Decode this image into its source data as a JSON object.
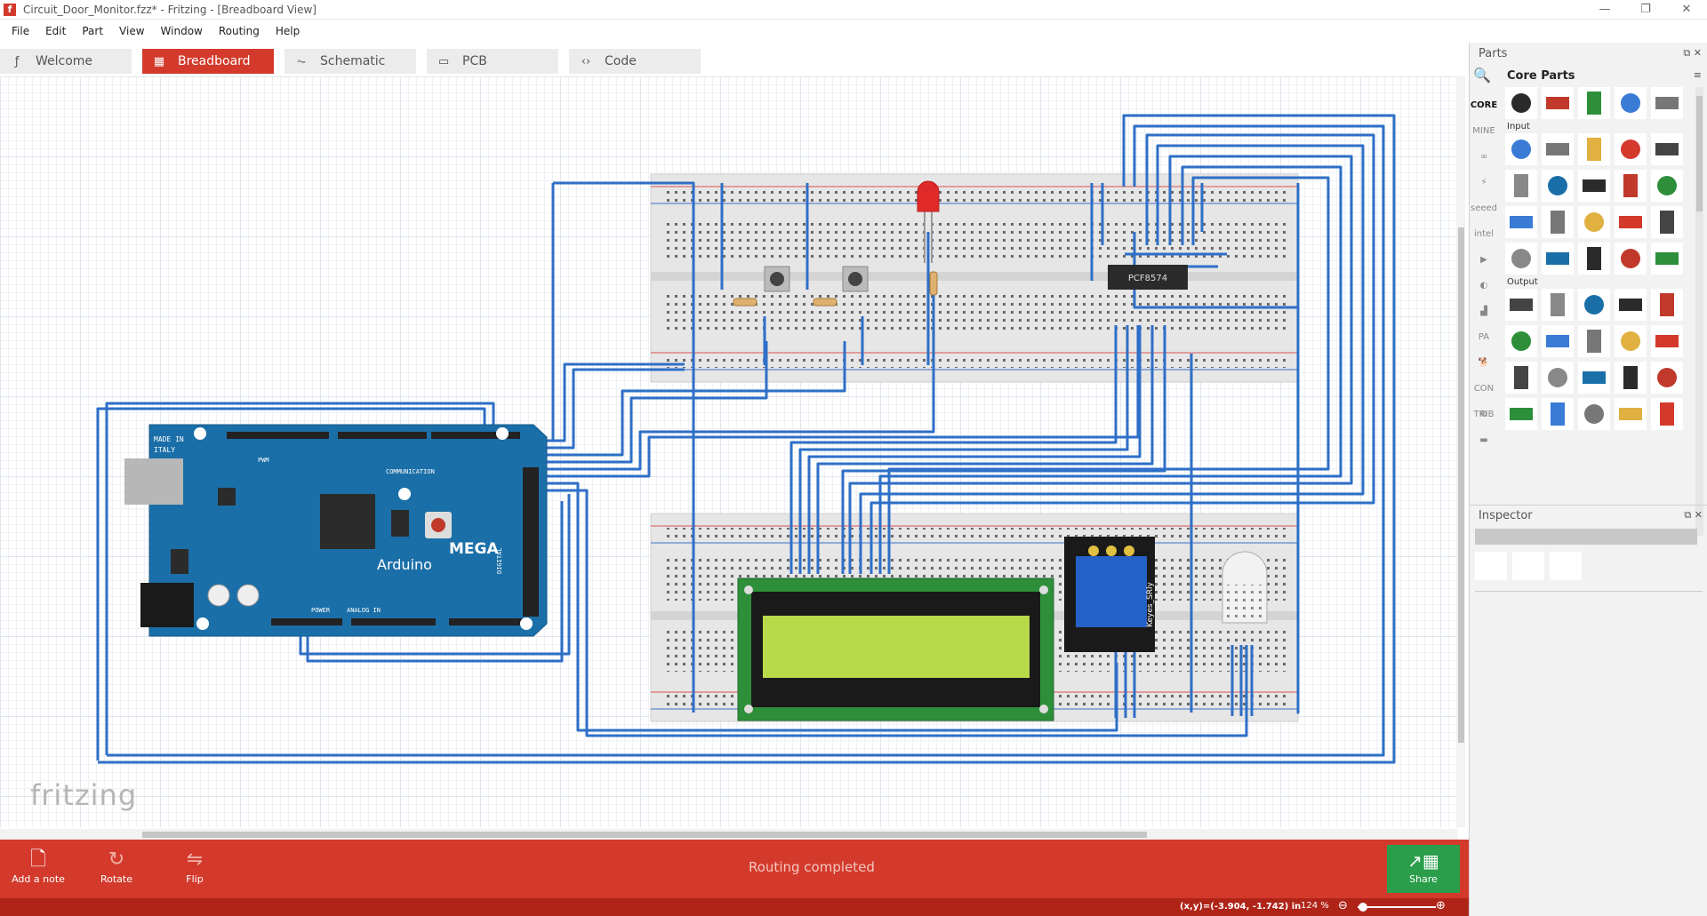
{
  "window": {
    "title": "Circuit_Door_Monitor.fzz* - Fritzing - [Breadboard View]",
    "controls": [
      "—",
      "❐",
      "✕"
    ]
  },
  "menu": [
    "File",
    "Edit",
    "Part",
    "View",
    "Window",
    "Routing",
    "Help"
  ],
  "tabs": [
    {
      "label": "Welcome",
      "icon": "ƒ"
    },
    {
      "label": "Breadboard",
      "icon": "▦"
    },
    {
      "label": "Schematic",
      "icon": "⏦"
    },
    {
      "label": "PCB",
      "icon": "▭"
    },
    {
      "label": "Code",
      "icon": "‹›"
    }
  ],
  "canvas": {
    "watermark": "fritzing",
    "labels": {
      "made_in": "MADE IN",
      "italy": "ITALY",
      "pwm": "PWM",
      "communication": "COMMUNICATION",
      "power": "POWER",
      "analog_in": "ANALOG IN",
      "digital": "DIGITAL",
      "mega": "MEGA",
      "arduino": "Arduino",
      "ic": "PCF8574",
      "relay_brand": "Keyes_SRly"
    }
  },
  "toolbar": {
    "add_note": "Add a note",
    "rotate": "Rotate",
    "flip": "Flip",
    "status": "Routing completed",
    "share": "Share"
  },
  "statusbar": {
    "coords": "(x,y)=(-3.904, -1.742) in",
    "zoom": "124 %"
  },
  "parts": {
    "title": "Parts",
    "bin_title": "Core Parts",
    "bins": [
      "CORE",
      "MINE",
      "∞",
      "⚡",
      "seeed",
      "intel",
      "▶",
      "◐",
      "▟",
      "PA",
      "🐕",
      "CON TRIB",
      "⚙",
      "▬"
    ],
    "sections": [
      "Input",
      "Output"
    ],
    "top_row_count": 5,
    "input_count": 20,
    "output_count": 20
  },
  "inspector": {
    "title": "Inspector"
  },
  "colors": {
    "accent": "#d33a2c",
    "wire": "#2e6fc7",
    "arduino": "#1b6fa8",
    "lcd_pcb": "#2d8f3a",
    "lcd_screen": "#b7d94a",
    "share": "#2b9e4b"
  }
}
